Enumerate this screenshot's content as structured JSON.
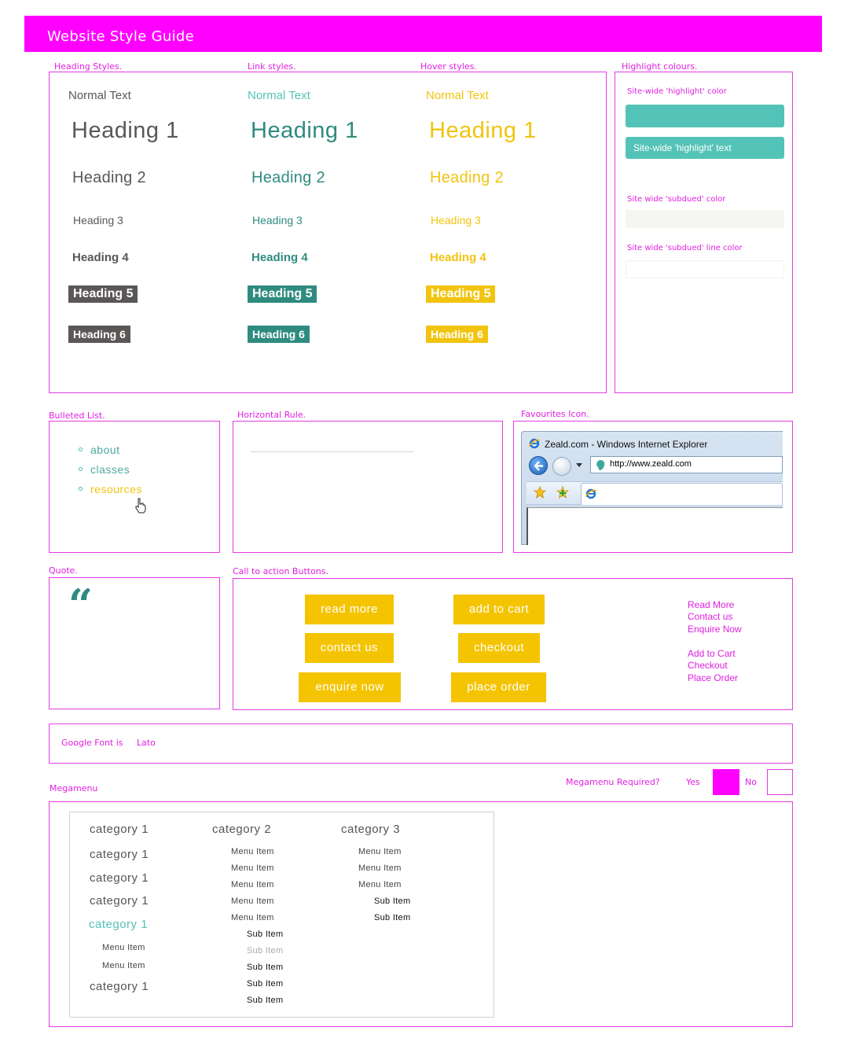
{
  "banner": {
    "title": "Website Style Guide"
  },
  "colors": {
    "magenta": "#ff00ff",
    "teal": "#2f8b7f",
    "highlight": "#54c3b7",
    "yellow": "#f1c40f",
    "grey": "#5a5756"
  },
  "sections": {
    "heading_styles": "Heading Styles.",
    "link_styles": "Link styles.",
    "hover_styles": "Hover styles.",
    "highlight_colours": "Highlight colours.",
    "bulleted_list": "Bulleted List.",
    "horizontal_rule": "Horizontal Rule.",
    "favourites_icon": "Favourites Icon.",
    "quote": "Quote.",
    "cta_buttons": "Call to action Buttons.",
    "megamenu": "Megamenu"
  },
  "typography": {
    "normal": "Normal Text",
    "h1": "Heading 1",
    "h2": "Heading 2",
    "h3": "Heading 3",
    "h4": "Heading 4",
    "h5": "Heading 5",
    "h6": "Heading 6"
  },
  "highlight": {
    "color_label": "Site-wide 'highlight' color",
    "text_label": "Site-wide 'highlight' text",
    "subdued_label": "Site wide 'subdued' color",
    "subdued_line_label": "Site wide 'subdued' line color"
  },
  "bullets": [
    "about",
    "classes",
    "resources"
  ],
  "browser": {
    "title": "Zeald.com - Windows Internet Explorer",
    "url": "http://www.zeald.com"
  },
  "quote": {
    "mark": "“"
  },
  "cta": {
    "buttons": [
      "read more",
      "add to cart",
      "contact us",
      "checkout",
      "enquire now",
      "place order"
    ],
    "links_group1": [
      "Read More",
      "Contact us",
      "Enquire Now"
    ],
    "links_group2": [
      "Add to Cart",
      "Checkout",
      "Place Order"
    ]
  },
  "font": {
    "label": "Google Font is",
    "value": "Lato"
  },
  "megamenu": {
    "required_label": "Megamenu Required?",
    "yes": "Yes",
    "no": "No",
    "col1": [
      "category 1",
      "category 1",
      "category 1",
      "category 1",
      "category 1",
      "Menu Item",
      "Menu Item",
      "category 1"
    ],
    "col2_header": "category 2",
    "col2": [
      "Menu Item",
      "Menu Item",
      "Menu Item",
      "Menu Item",
      "Menu Item",
      "Sub Item",
      "Sub Item",
      "Sub Item",
      "Sub Item",
      "Sub Item"
    ],
    "col3_header": "category 3",
    "col3": [
      "Menu Item",
      "Menu Item",
      "Menu Item",
      "Sub Item",
      "Sub Item"
    ]
  }
}
